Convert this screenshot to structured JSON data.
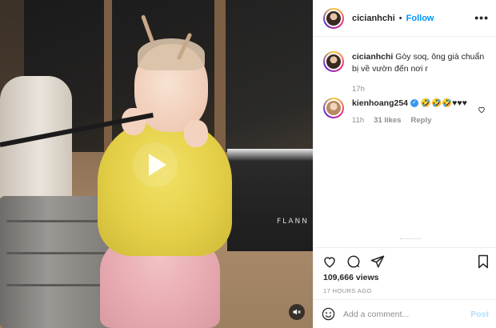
{
  "post": {
    "username": "cicianhchi",
    "follow_label": "Follow",
    "separator": "•",
    "more_label": "•••"
  },
  "caption": {
    "username": "cicianhchi",
    "text": "Gòy soq, ông già chuẩn bị về vườn đến nơi r",
    "time": "17h"
  },
  "comments": [
    {
      "username": "kienhoang254",
      "verified": true,
      "text": "🤣🤣🤣♥♥♥",
      "time": "11h",
      "likes": "31 likes",
      "reply_label": "Reply"
    }
  ],
  "video": {
    "bag_brand": "FLANN"
  },
  "stats": {
    "views": "109,666 views",
    "time_ago": "17 HOURS AGO"
  },
  "comment_box": {
    "placeholder": "Add a comment...",
    "post_label": "Post"
  },
  "icons": [
    "play-icon",
    "mute-icon",
    "heart-icon",
    "comment-icon",
    "share-icon",
    "save-icon",
    "emoji-icon",
    "like-comment-icon"
  ],
  "colors": {
    "link": "#0095f6",
    "verified": "#3897f0",
    "post_disabled": "#b2dffc",
    "muted": "#8e8e8e"
  }
}
